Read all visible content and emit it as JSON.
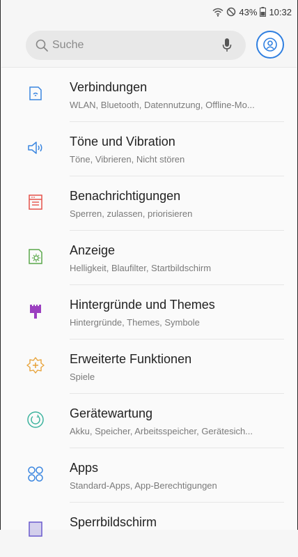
{
  "status": {
    "battery_percent": "43%",
    "time": "10:32"
  },
  "search": {
    "placeholder": "Suche"
  },
  "items": [
    {
      "title": "Verbindungen",
      "subtitle": "WLAN, Bluetooth, Datennutzung, Offline-Mo...",
      "icon": "connections-icon",
      "color": "#3a86e0"
    },
    {
      "title": "Töne und Vibration",
      "subtitle": "Töne, Vibrieren, Nicht stören",
      "icon": "sound-icon",
      "color": "#3a86e0"
    },
    {
      "title": "Benachrichtigungen",
      "subtitle": "Sperren, zulassen, priorisieren",
      "icon": "notifications-icon",
      "color": "#e5534b"
    },
    {
      "title": "Anzeige",
      "subtitle": "Helligkeit, Blaufilter, Startbildschirm",
      "icon": "display-icon",
      "color": "#5aa84a"
    },
    {
      "title": "Hintergründe und Themes",
      "subtitle": "Hintergründe, Themes, Symbole",
      "icon": "themes-icon",
      "color": "#9b3fc0"
    },
    {
      "title": "Erweiterte Funktionen",
      "subtitle": "Spiele",
      "icon": "advanced-features-icon",
      "color": "#e8a33a"
    },
    {
      "title": "Gerätewartung",
      "subtitle": "Akku, Speicher, Arbeitsspeicher, Gerätesich...",
      "icon": "device-maintenance-icon",
      "color": "#3db39e"
    },
    {
      "title": "Apps",
      "subtitle": "Standard-Apps, App-Berechtigungen",
      "icon": "apps-icon",
      "color": "#3a86e0"
    },
    {
      "title": "Sperrbildschirm",
      "subtitle": "",
      "icon": "lockscreen-icon",
      "color": "#6a5acd"
    }
  ]
}
